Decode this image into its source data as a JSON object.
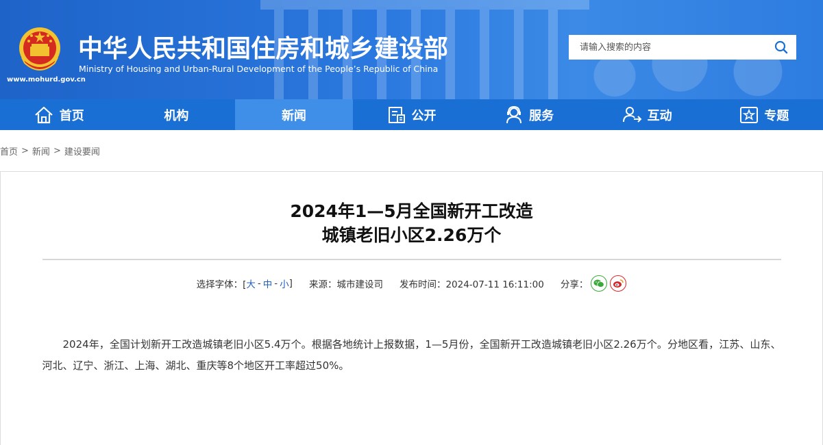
{
  "header": {
    "site_url": "www.mohurd.gov.cn",
    "title_cn": "中华人民共和国住房和城乡建设部",
    "title_en": "Ministry of Housing and Urban-Rural Development of the People’s Republic of China",
    "search_placeholder": "请输入搜索的内容"
  },
  "nav": {
    "items": [
      {
        "label": "首页",
        "icon": "home-icon"
      },
      {
        "label": "机构",
        "icon": ""
      },
      {
        "label": "新闻",
        "icon": "",
        "active": true
      },
      {
        "label": "公开",
        "icon": "document-icon"
      },
      {
        "label": "服务",
        "icon": "user-service-icon"
      },
      {
        "label": "互动",
        "icon": "interaction-icon"
      },
      {
        "label": "专题",
        "icon": "star-icon"
      }
    ]
  },
  "breadcrumb": {
    "home": "首页",
    "news": "新闻",
    "current": "建设要闻",
    "sep": ">"
  },
  "article": {
    "title_line1": "2024年1—5月全国新开工改造",
    "title_line2": "城镇老旧小区2.26万个",
    "font_label": "选择字体：[",
    "font_large": "大",
    "font_medium": "中",
    "font_small": "小",
    "font_dash": "-",
    "font_close": "]",
    "source_label": "来源：城市建设司",
    "publish_label": "发布时间：2024-07-11 16:11:00",
    "share_label": "分享：",
    "body": "2024年，全国计划新开工改造城镇老旧小区5.4万个。根据各地统计上报数据，1—5月份，全国新开工改造城镇老旧小区2.26万个。分地区看，江苏、山东、河北、辽宁、浙江、上海、湖北、重庆等8个地区开工率超过50%。"
  },
  "colors": {
    "header_blue": "#1e63c8",
    "nav_blue": "#1a6fd4",
    "nav_active": "#3f8fe8",
    "link_blue": "#1f5fc2",
    "wechat_green": "#3aa83a",
    "weibo_red": "#d6262c"
  }
}
